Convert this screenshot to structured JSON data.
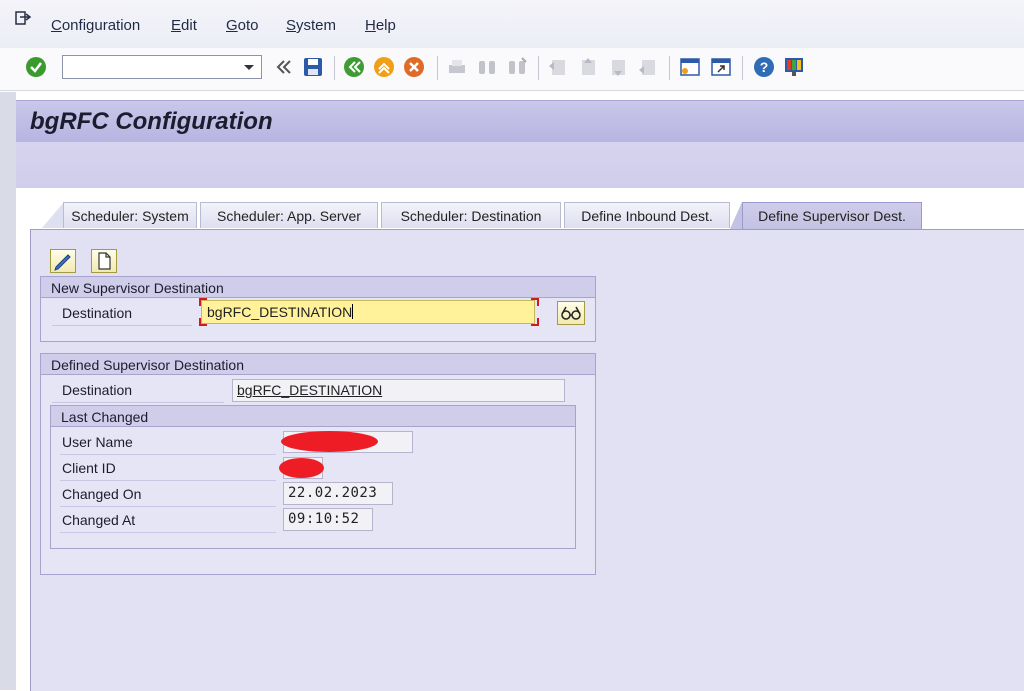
{
  "menu": {
    "items": [
      {
        "label": "Configuration"
      },
      {
        "label": "Edit"
      },
      {
        "label": "Goto"
      },
      {
        "label": "System"
      },
      {
        "label": "Help"
      }
    ]
  },
  "toolbar": {
    "command_value": "",
    "icons": [
      "enter-check-icon",
      "save-icon",
      "back-icon",
      "exit-icon",
      "cancel-icon",
      "print-icon",
      "find-icon",
      "find-next-icon",
      "first-page-icon",
      "previous-page-icon",
      "next-page-icon",
      "last-page-icon",
      "create-session-icon",
      "shortcut-icon",
      "help-icon",
      "customize-layout-icon"
    ]
  },
  "page": {
    "title": "bgRFC Configuration"
  },
  "tabs": [
    {
      "label": "Scheduler: System",
      "active": false
    },
    {
      "label": "Scheduler: App. Server",
      "active": false
    },
    {
      "label": "Scheduler: Destination",
      "active": false
    },
    {
      "label": "Define Inbound Dest.",
      "active": false
    },
    {
      "label": "Define Supervisor Dest.",
      "active": true
    }
  ],
  "new_supervisor": {
    "header": "New Supervisor Destination",
    "destination_label": "Destination",
    "destination_value": "bgRFC_DESTINATION"
  },
  "defined_supervisor": {
    "header": "Defined Supervisor Destination",
    "destination_label": "Destination",
    "destination_value": "bgRFC_DESTINATION",
    "last_changed": {
      "header": "Last Changed",
      "user_name_label": "User Name",
      "client_id_label": "Client ID",
      "changed_on_label": "Changed On",
      "changed_on_value": "22.02.2023",
      "changed_at_label": "Changed At",
      "changed_at_value": "09:10:52"
    }
  },
  "colors": {
    "title_bar": "#b7b4e1",
    "content_bg": "#e2e1f4",
    "input_highlight": "#fff29a",
    "redaction": "#ee1c24"
  }
}
